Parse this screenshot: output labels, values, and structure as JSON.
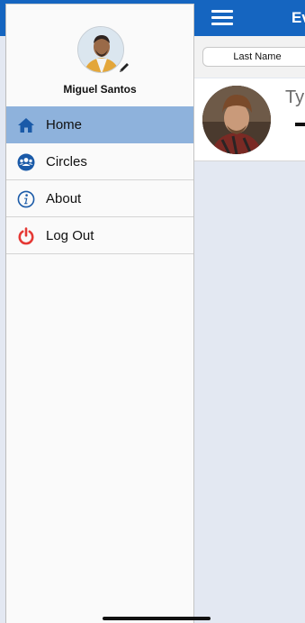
{
  "main_screen": {
    "header_title": "Ev",
    "sort_button": "Last Name",
    "person": {
      "name": "Tyl"
    }
  },
  "drawer": {
    "user_name": "Miguel Santos",
    "menu": [
      {
        "label": "Home",
        "icon": "home-icon",
        "active": true
      },
      {
        "label": "Circles",
        "icon": "users-icon",
        "active": false
      },
      {
        "label": "About",
        "icon": "info-icon",
        "active": false
      },
      {
        "label": "Log Out",
        "icon": "power-icon",
        "active": false
      }
    ]
  },
  "colors": {
    "header": "#1565c0",
    "active_item": "#8eb2dc",
    "icon_blue": "#1a5aa8",
    "logout_red": "#e53935"
  }
}
